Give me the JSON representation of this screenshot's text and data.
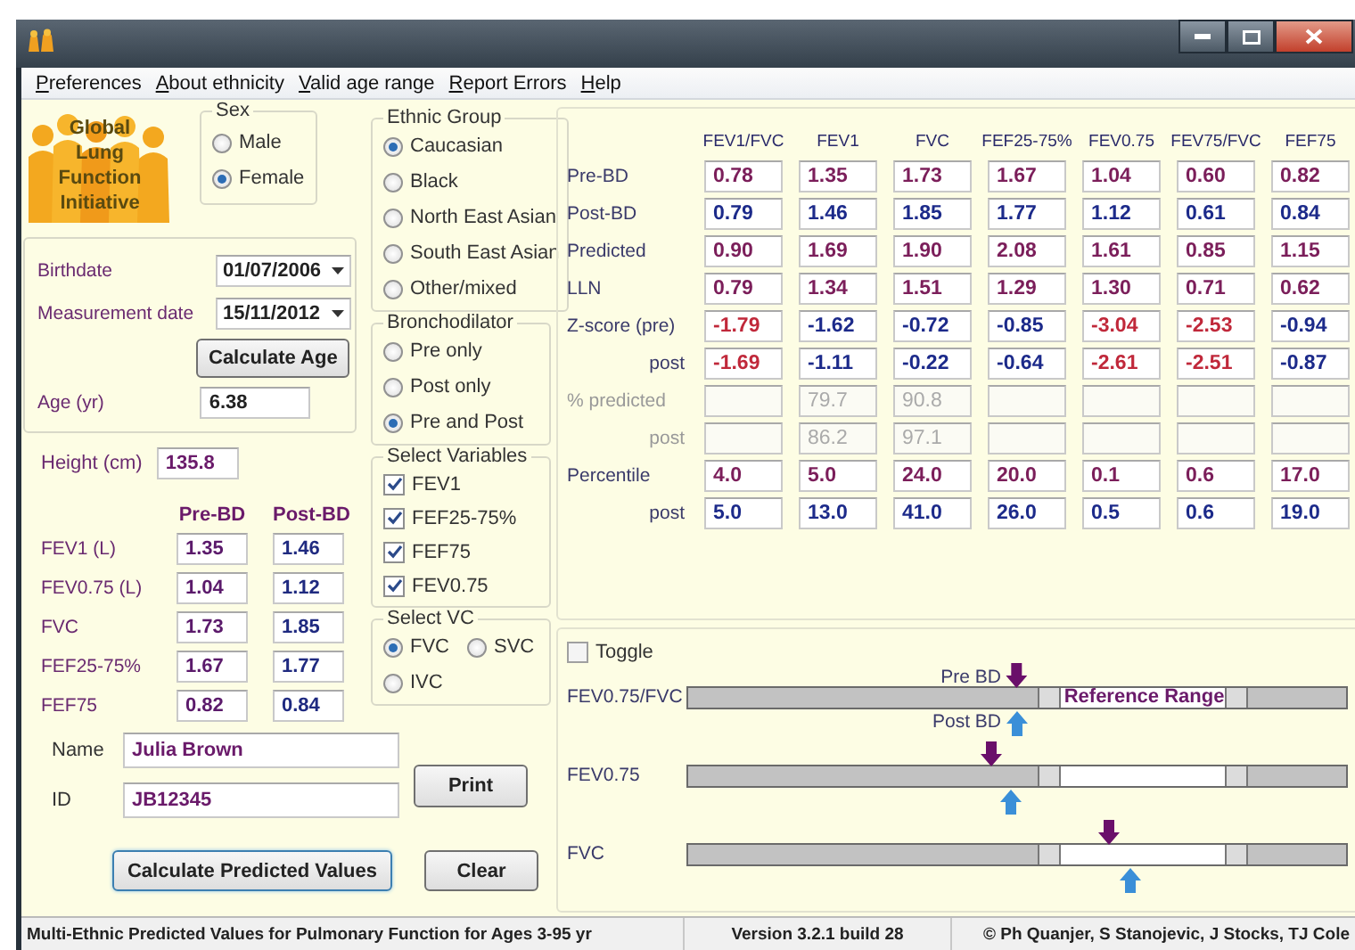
{
  "menu": [
    "Preferences",
    "About ethnicity",
    "Valid age range",
    "Report Errors",
    "Help"
  ],
  "logo": {
    "lines": [
      "Global",
      "Lung",
      "Function",
      "Initiative"
    ]
  },
  "sex": {
    "label": "Sex",
    "options": [
      {
        "label": "Male",
        "selected": false
      },
      {
        "label": "Female",
        "selected": true
      }
    ]
  },
  "dates": {
    "birthdate": {
      "label": "Birthdate",
      "value": "01/07/2006"
    },
    "measurement_date": {
      "label": "Measurement date",
      "value": "15/11/2012"
    },
    "calculate_age_button": "Calculate Age",
    "age": {
      "label": "Age (yr)",
      "value": "6.38"
    }
  },
  "height": {
    "label": "Height (cm)",
    "value": "135.8"
  },
  "measurements": {
    "columns": [
      "Pre-BD",
      "Post-BD"
    ],
    "rows": [
      {
        "label": "FEV1 (L)",
        "values": [
          "1.35",
          "1.46"
        ]
      },
      {
        "label": "FEV0.75 (L)",
        "values": [
          "1.04",
          "1.12"
        ]
      },
      {
        "label": "FVC",
        "values": [
          "1.73",
          "1.85"
        ]
      },
      {
        "label": "FEF25-75%",
        "values": [
          "1.67",
          "1.77"
        ]
      },
      {
        "label": "FEF75",
        "values": [
          "0.82",
          "0.84"
        ]
      }
    ]
  },
  "ethnic_group": {
    "label": "Ethnic Group",
    "options": [
      {
        "label": "Caucasian",
        "selected": true
      },
      {
        "label": "Black",
        "selected": false
      },
      {
        "label": "North East Asian",
        "selected": false
      },
      {
        "label": "South East Asian",
        "selected": false
      },
      {
        "label": "Other/mixed",
        "selected": false
      }
    ]
  },
  "bronchodilator": {
    "label": "Bronchodilator",
    "options": [
      {
        "label": "Pre only",
        "selected": false
      },
      {
        "label": "Post only",
        "selected": false
      },
      {
        "label": "Pre and Post",
        "selected": true
      }
    ]
  },
  "select_variables": {
    "label": "Select Variables",
    "items": [
      {
        "label": "FEV1",
        "checked": true
      },
      {
        "label": "FEF25-75%",
        "checked": true
      },
      {
        "label": "FEF75",
        "checked": true
      },
      {
        "label": "FEV0.75",
        "checked": true
      }
    ]
  },
  "select_vc": {
    "label": "Select VC",
    "options": [
      {
        "label": "FVC",
        "selected": true
      },
      {
        "label": "SVC",
        "selected": false
      },
      {
        "label": "IVC",
        "selected": false
      }
    ]
  },
  "patient": {
    "name": {
      "label": "Name",
      "value": "Julia Brown"
    },
    "id": {
      "label": "ID",
      "value": "JB12345"
    }
  },
  "buttons": {
    "print": "Print",
    "calculate_predicted": "Calculate Predicted Values",
    "clear": "Clear"
  },
  "results": {
    "columns": [
      "FEV1/FVC",
      "FEV1",
      "FVC",
      "FEF25-75%",
      "FEV0.75",
      "FEV75/FVC",
      "FEF75"
    ],
    "rows": [
      {
        "label": "Pre-BD",
        "kind": "value",
        "sub": false,
        "disabled": false,
        "color": "#7b1e5a",
        "cells": [
          "0.78",
          "1.35",
          "1.73",
          "1.67",
          "1.04",
          "0.60",
          "0.82"
        ]
      },
      {
        "label": "Post-BD",
        "kind": "value",
        "sub": false,
        "disabled": false,
        "color": "#1c2a8a",
        "cells": [
          "0.79",
          "1.46",
          "1.85",
          "1.77",
          "1.12",
          "0.61",
          "0.84"
        ]
      },
      {
        "label": "Predicted",
        "kind": "value",
        "sub": false,
        "disabled": false,
        "color": "#7b1e5a",
        "cells": [
          "0.90",
          "1.69",
          "1.90",
          "2.08",
          "1.61",
          "0.85",
          "1.15"
        ]
      },
      {
        "label": "LLN",
        "kind": "value",
        "sub": false,
        "disabled": false,
        "color": "#7b1e5a",
        "cells": [
          "0.79",
          "1.34",
          "1.51",
          "1.29",
          "1.30",
          "0.71",
          "0.62"
        ]
      },
      {
        "label": "Z-score (pre)",
        "kind": "zscore",
        "sub": false,
        "disabled": false,
        "color": "#1c2a8a",
        "cells": [
          {
            "value": "-1.79",
            "abnormal": true
          },
          {
            "value": "-1.62",
            "abnormal": false
          },
          {
            "value": "-0.72",
            "abnormal": false
          },
          {
            "value": "-0.85",
            "abnormal": false
          },
          {
            "value": "-3.04",
            "abnormal": true
          },
          {
            "value": "-2.53",
            "abnormal": true
          },
          {
            "value": "-0.94",
            "abnormal": false
          }
        ]
      },
      {
        "label": "post",
        "kind": "zscore",
        "sub": true,
        "disabled": false,
        "color": "#1c2a8a",
        "cells": [
          {
            "value": "-1.69",
            "abnormal": true
          },
          {
            "value": "-1.11",
            "abnormal": false
          },
          {
            "value": "-0.22",
            "abnormal": false
          },
          {
            "value": "-0.64",
            "abnormal": false
          },
          {
            "value": "-2.61",
            "abnormal": true
          },
          {
            "value": "-2.51",
            "abnormal": true
          },
          {
            "value": "-0.87",
            "abnormal": false
          }
        ]
      },
      {
        "label": "% predicted",
        "kind": "value",
        "sub": false,
        "disabled": true,
        "cells": [
          null,
          "79.7",
          "90.8",
          null,
          null,
          null,
          null
        ]
      },
      {
        "label": "post",
        "kind": "value",
        "sub": true,
        "disabled": true,
        "cells": [
          null,
          "86.2",
          "97.1",
          null,
          null,
          null,
          null
        ]
      },
      {
        "label": "Percentile",
        "kind": "value",
        "sub": false,
        "disabled": false,
        "color": "#7b1e5a",
        "cells": [
          "4.0",
          "5.0",
          "24.0",
          "20.0",
          "0.1",
          "0.6",
          "17.0"
        ]
      },
      {
        "label": "post",
        "kind": "value",
        "sub": true,
        "disabled": false,
        "color": "#1c2a8a",
        "cells": [
          "5.0",
          "13.0",
          "41.0",
          "26.0",
          "0.5",
          "0.6",
          "19.0"
        ]
      }
    ]
  },
  "ranges": {
    "toggle": {
      "label": "Toggle",
      "checked": false
    },
    "bars": [
      {
        "label": "FEV0.75/FVC",
        "range_label": "Reference Range",
        "markers": [
          {
            "kind": "pre",
            "label": "Pre BD"
          },
          {
            "kind": "post",
            "label": "Post BD"
          }
        ]
      },
      {
        "label": "FEV0.75",
        "markers": [
          {
            "kind": "pre"
          },
          {
            "kind": "post"
          }
        ]
      },
      {
        "label": "FVC",
        "markers": [
          {
            "kind": "pre"
          },
          {
            "kind": "post"
          }
        ]
      }
    ]
  },
  "status_bar": [
    "Multi-Ethnic Predicted Values for Pulmonary Function for Ages 3-95 yr",
    "Version 3.2.1 build 28",
    "© Ph Quanjer, S Stanojevic, J Stocks, TJ Cole"
  ]
}
